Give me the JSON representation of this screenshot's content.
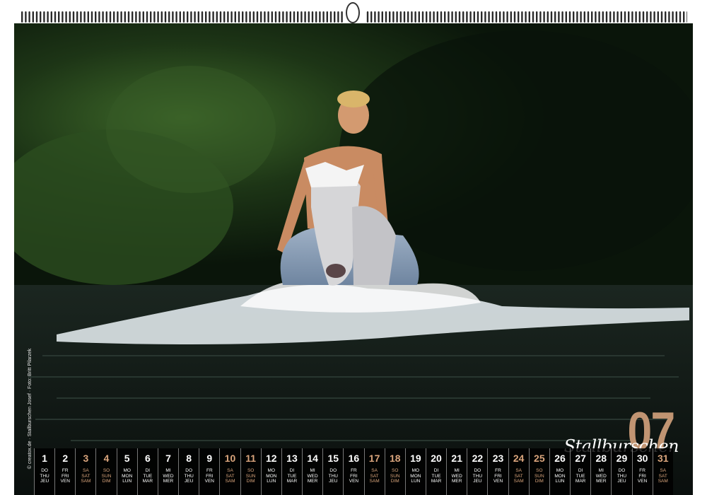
{
  "calendar": {
    "month_number": "07",
    "brand": "Stallburschen",
    "credit": "© creatox.de · Stallburschen Josef · Foto: Britt Pilarzek"
  },
  "colors": {
    "accent": "#c09472",
    "strip": "#000000",
    "text": "#ffffff"
  },
  "days": [
    {
      "n": "1",
      "de": "DO",
      "en": "THU",
      "fr": "JEU",
      "weekend": false
    },
    {
      "n": "2",
      "de": "FR",
      "en": "FRI",
      "fr": "VEN",
      "weekend": false
    },
    {
      "n": "3",
      "de": "SA",
      "en": "SAT",
      "fr": "SAM",
      "weekend": true
    },
    {
      "n": "4",
      "de": "SO",
      "en": "SUN",
      "fr": "DIM",
      "weekend": true
    },
    {
      "n": "5",
      "de": "MO",
      "en": "MON",
      "fr": "LUN",
      "weekend": false
    },
    {
      "n": "6",
      "de": "DI",
      "en": "TUE",
      "fr": "MAR",
      "weekend": false
    },
    {
      "n": "7",
      "de": "MI",
      "en": "WED",
      "fr": "MER",
      "weekend": false
    },
    {
      "n": "8",
      "de": "DO",
      "en": "THU",
      "fr": "JEU",
      "weekend": false
    },
    {
      "n": "9",
      "de": "FR",
      "en": "FRI",
      "fr": "VEN",
      "weekend": false
    },
    {
      "n": "10",
      "de": "SA",
      "en": "SAT",
      "fr": "SAM",
      "weekend": true
    },
    {
      "n": "11",
      "de": "SO",
      "en": "SUN",
      "fr": "DIM",
      "weekend": true
    },
    {
      "n": "12",
      "de": "MO",
      "en": "MON",
      "fr": "LUN",
      "weekend": false
    },
    {
      "n": "13",
      "de": "DI",
      "en": "TUE",
      "fr": "MAR",
      "weekend": false
    },
    {
      "n": "14",
      "de": "MI",
      "en": "WED",
      "fr": "MER",
      "weekend": false
    },
    {
      "n": "15",
      "de": "DO",
      "en": "THU",
      "fr": "JEU",
      "weekend": false
    },
    {
      "n": "16",
      "de": "FR",
      "en": "FRI",
      "fr": "VEN",
      "weekend": false
    },
    {
      "n": "17",
      "de": "SA",
      "en": "SAT",
      "fr": "SAM",
      "weekend": true
    },
    {
      "n": "18",
      "de": "SO",
      "en": "SUN",
      "fr": "DIM",
      "weekend": true
    },
    {
      "n": "19",
      "de": "MO",
      "en": "MON",
      "fr": "LUN",
      "weekend": false
    },
    {
      "n": "20",
      "de": "DI",
      "en": "TUE",
      "fr": "MAR",
      "weekend": false
    },
    {
      "n": "21",
      "de": "MI",
      "en": "WED",
      "fr": "MER",
      "weekend": false
    },
    {
      "n": "22",
      "de": "DO",
      "en": "THU",
      "fr": "JEU",
      "weekend": false
    },
    {
      "n": "23",
      "de": "FR",
      "en": "FRI",
      "fr": "VEN",
      "weekend": false
    },
    {
      "n": "24",
      "de": "SA",
      "en": "SAT",
      "fr": "SAM",
      "weekend": true
    },
    {
      "n": "25",
      "de": "SO",
      "en": "SUN",
      "fr": "DIM",
      "weekend": true
    },
    {
      "n": "26",
      "de": "MO",
      "en": "MON",
      "fr": "LUN",
      "weekend": false
    },
    {
      "n": "27",
      "de": "DI",
      "en": "TUE",
      "fr": "MAR",
      "weekend": false
    },
    {
      "n": "28",
      "de": "MI",
      "en": "WED",
      "fr": "MER",
      "weekend": false
    },
    {
      "n": "29",
      "de": "DO",
      "en": "THU",
      "fr": "JEU",
      "weekend": false
    },
    {
      "n": "30",
      "de": "FR",
      "en": "FRI",
      "fr": "VEN",
      "weekend": false
    },
    {
      "n": "31",
      "de": "SA",
      "en": "SAT",
      "fr": "SAM",
      "weekend": true
    }
  ]
}
